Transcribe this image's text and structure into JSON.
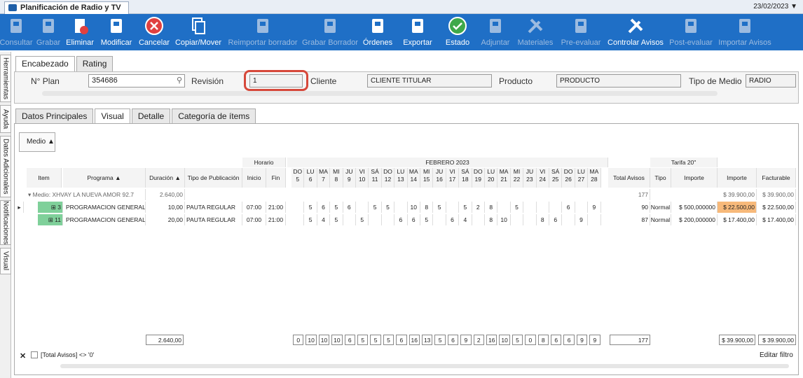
{
  "window": {
    "title": "Planificación de Radio y TV",
    "date": "23/02/2023"
  },
  "toolbar": [
    {
      "label": "Consultar",
      "enabled": false
    },
    {
      "label": "Grabar",
      "enabled": false
    },
    {
      "label": "Eliminar",
      "enabled": true
    },
    {
      "label": "Modificar",
      "enabled": true
    },
    {
      "label": "Cancelar",
      "enabled": true
    },
    {
      "label": "Copiar/Mover",
      "enabled": true
    },
    {
      "label": "Reimportar borrador",
      "enabled": false
    },
    {
      "label": "Grabar Borrador",
      "enabled": false
    },
    {
      "label": "Órdenes",
      "enabled": true
    },
    {
      "label": "Exportar",
      "enabled": true
    },
    {
      "label": "Estado",
      "enabled": true
    },
    {
      "label": "Adjuntar",
      "enabled": false
    },
    {
      "label": "Materiales",
      "enabled": false
    },
    {
      "label": "Pre-evaluar",
      "enabled": false
    },
    {
      "label": "Controlar Avisos",
      "enabled": true
    },
    {
      "label": "Post-evaluar",
      "enabled": false
    },
    {
      "label": "Importar Avisos",
      "enabled": false
    }
  ],
  "sidetabs": [
    "Herramientas",
    "Ayuda",
    "Datos Adicionales",
    "Notificaciones",
    "Visual"
  ],
  "header": {
    "tabs": [
      "Encabezado",
      "Rating"
    ],
    "plan_label": "N° Plan",
    "plan_value": "354686",
    "revision_label": "Revisión",
    "revision_value": "1",
    "cliente_label": "Cliente",
    "cliente_value": "CLIENTE TITULAR",
    "producto_label": "Producto",
    "producto_value": "PRODUCTO",
    "tipo_label": "Tipo de Medio",
    "tipo_value": "RADIO"
  },
  "tabs": [
    "Datos Principales",
    "Visual",
    "Detalle",
    "Categoría de ítems"
  ],
  "medio_button": "Medio",
  "grid": {
    "horario": "Horario",
    "month": "FEBRERO 2023",
    "tarifa": "Tarifa 20\"",
    "cols": {
      "item": "Item",
      "programa": "Programa",
      "duracion": "Duración",
      "tipo_pub": "Tipo de Publicación",
      "inicio": "Inicio",
      "fin": "Fin",
      "total": "Total Avisos",
      "tipo": "Tipo",
      "importe_t": "Importe",
      "importe": "Importe",
      "facturable": "Facturable"
    },
    "days": [
      [
        "DO",
        "5"
      ],
      [
        "LU",
        "6"
      ],
      [
        "MA",
        "7"
      ],
      [
        "MI",
        "8"
      ],
      [
        "JU",
        "9"
      ],
      [
        "VI",
        "10"
      ],
      [
        "SÁ",
        "11"
      ],
      [
        "DO",
        "12"
      ],
      [
        "LU",
        "13"
      ],
      [
        "MA",
        "14"
      ],
      [
        "MI",
        "15"
      ],
      [
        "JU",
        "16"
      ],
      [
        "VI",
        "17"
      ],
      [
        "SÁ",
        "18"
      ],
      [
        "DO",
        "19"
      ],
      [
        "LU",
        "20"
      ],
      [
        "MA",
        "21"
      ],
      [
        "MI",
        "22"
      ],
      [
        "JU",
        "23"
      ],
      [
        "VI",
        "24"
      ],
      [
        "SÁ",
        "25"
      ],
      [
        "DO",
        "26"
      ],
      [
        "LU",
        "27"
      ],
      [
        "MA",
        "28"
      ]
    ],
    "group": {
      "label": "Medio: XHVAY LA NUEVA AMOR 92.7",
      "duracion": "2.640,00",
      "total": "177",
      "importe": "$ 39.900,00",
      "facturable": "$ 39.900,00"
    },
    "rows": [
      {
        "item": "3",
        "programa": "PROGRAMACION GENERAL",
        "duracion": "10,00",
        "tipo_pub": "PAUTA REGULAR",
        "inicio": "07:00",
        "fin": "21:00",
        "days": [
          "",
          "5",
          "6",
          "5",
          "6",
          "",
          "5",
          "5",
          "",
          "10",
          "8",
          "5",
          "",
          "5",
          "2",
          "8",
          "",
          "5",
          "",
          "",
          "",
          "6",
          "",
          "9"
        ],
        "total": "90",
        "tipo": "Normal",
        "importe_t": "$ 500,000000",
        "importe": "$ 22.500,00",
        "facturable": "$ 22.500,00"
      },
      {
        "item": "11",
        "programa": "PROGRAMACION GENERAL",
        "duracion": "20,00",
        "tipo_pub": "PAUTA REGULAR",
        "inicio": "07:00",
        "fin": "21:00",
        "days": [
          "",
          "5",
          "4",
          "5",
          "",
          "5",
          "",
          "",
          "6",
          "6",
          "5",
          "",
          "6",
          "4",
          "",
          "8",
          "10",
          "",
          "",
          "8",
          "6",
          "",
          "9",
          ""
        ],
        "total": "87",
        "tipo": "Normal",
        "importe_t": "$ 200,000000",
        "importe": "$ 17.400,00",
        "facturable": "$ 17.400,00"
      }
    ],
    "totals": {
      "duracion": "2.640,00",
      "days": [
        "0",
        "10",
        "10",
        "10",
        "6",
        "5",
        "5",
        "5",
        "6",
        "16",
        "13",
        "5",
        "6",
        "9",
        "2",
        "16",
        "10",
        "5",
        "0",
        "8",
        "6",
        "6",
        "9",
        "9"
      ],
      "total": "177",
      "importe": "$ 39.900,00",
      "facturable": "$ 39.900,00"
    }
  },
  "filter": {
    "text": "[Total Avisos] <> '0'",
    "edit": "Editar filtro"
  }
}
